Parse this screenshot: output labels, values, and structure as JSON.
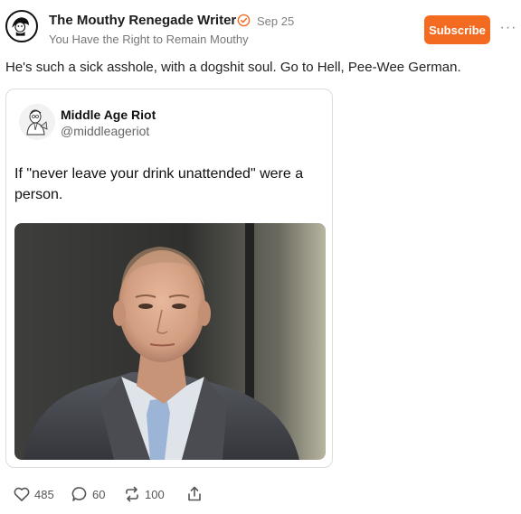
{
  "publication": {
    "name": "The Mouthy Renegade Writer",
    "date": "Sep 25",
    "tagline": "You Have the Right to Remain Mouthy",
    "subscribe_label": "Subscribe",
    "more_label": "···"
  },
  "post": {
    "body": "He's such a sick asshole, with a dogshit soul. Go to Hell, Pee-Wee German."
  },
  "embed": {
    "author_name": "Middle Age Riot",
    "author_handle": "@middleageriot",
    "text": "If \"never leave your drink unattended\" were a person."
  },
  "actions": {
    "likes": "485",
    "comments": "60",
    "restacks": "100"
  },
  "colors": {
    "accent": "#f36b21",
    "verified": "#f36b21",
    "muted": "#808080"
  },
  "icons": [
    "heart-icon",
    "comment-icon",
    "restack-icon",
    "share-icon",
    "verified-check-icon",
    "more-icon"
  ]
}
